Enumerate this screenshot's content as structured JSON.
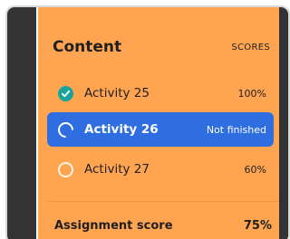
{
  "content": {
    "title": "Content",
    "scores_label": "SCORES"
  },
  "activities": [
    {
      "name": "Activity 25",
      "score": "100%",
      "status": "completed"
    },
    {
      "name": "Activity 26",
      "score": "Not finished",
      "status": "in-progress",
      "selected": true
    },
    {
      "name": "Activity 27",
      "score": "60%",
      "status": "not-completed"
    }
  ],
  "assignment": {
    "label": "Assignment score",
    "value": "75%"
  },
  "colors": {
    "panel": "#ffa552",
    "selected_row": "#2f6ee0",
    "completed": "#1aa39a",
    "sidebar": "#333333"
  },
  "icons": {
    "completed": "check-circle-icon",
    "in_progress": "progress-ring-icon",
    "not_completed": "empty-circle-icon"
  }
}
